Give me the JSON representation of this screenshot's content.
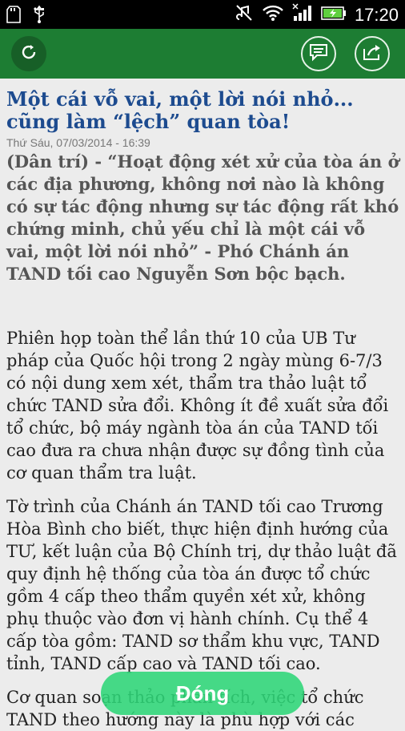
{
  "status_bar": {
    "time": "17:20",
    "icons": [
      "sd-card-icon",
      "usb-icon",
      "mute-icon",
      "wifi-icon",
      "signal-icon",
      "battery-icon"
    ]
  },
  "toolbar": {
    "refresh_icon": "refresh-icon",
    "comment_icon": "comment-icon",
    "share_icon": "share-icon",
    "accent_color": "#1d7d33"
  },
  "article": {
    "title": "Một cái vỗ vai, một lời nói nhỏ... cũng làm “lệch” quan tòa!",
    "date": "Thứ Sáu, 07/03/2014 - 16:39",
    "lead": "(Dân trí) - “Hoạt động xét xử của tòa án ở các địa phương, không nơi nào là không có sự tác động nhưng sự tác động rất khó chứng minh, chủ yếu chỉ là một cái vỗ vai, một lời nói nhỏ” - Phó Chánh án TAND tối cao Nguyễn Sơn bộc bạch.",
    "paragraphs": [
      "Phiên họp toàn thể lần thứ 10 của UB Tư pháp của Quốc hội trong 2 ngày mùng 6-7/3 có nội dung xem xét, thẩm tra thảo luật tổ chức TAND sửa đổi. Không ít đề xuất sửa đổi tổ chức, bộ máy ngành tòa án của TAND tối cao đưa ra chưa nhận được sự đồng tình của cơ quan thẩm tra luật.",
      "Tờ trình của Chánh án TAND tối cao Trương Hòa Bình cho biết, thực hiện định hướng của TƯ, kết luận của Bộ Chính trị, dự thảo luật đã quy định hệ thống của tòa án được tổ chức gồm 4 cấp theo thẩm quyền xét xử, không phụ thuộc vào đơn vị hành chính. Cụ thể 4 cấp tòa gồm: TAND sơ thẩm khu vực, TAND tỉnh, TAND cấp cao và TAND tối cao.",
      "Cơ quan soạn thảo phân tích, việc tổ chức TAND theo hướng này là phù hợp với các"
    ]
  },
  "close_button": {
    "label": "Đóng"
  }
}
